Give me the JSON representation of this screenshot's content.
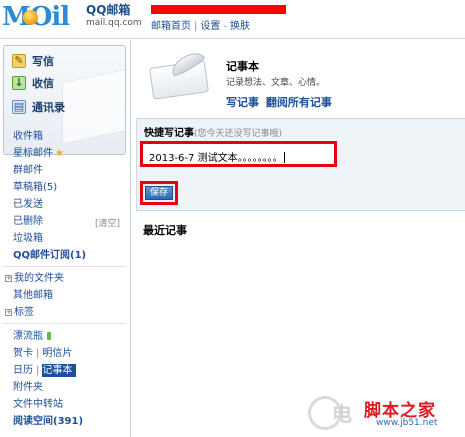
{
  "header": {
    "logo_text": "MOil",
    "brand_name": "QQ邮箱",
    "brand_domain": "mail.qq.com",
    "links": [
      "邮箱首页",
      "设置",
      "换肤"
    ],
    "colors": {
      "logo": "#2a8ad6",
      "redaction": "#ff0000"
    }
  },
  "sidebar": {
    "actions": [
      {
        "label": "写信",
        "icon": "pencil-icon"
      },
      {
        "label": "收信",
        "icon": "inbox-icon"
      },
      {
        "label": "通讯录",
        "icon": "address-book-icon"
      }
    ],
    "folders": {
      "inbox": "收件箱",
      "starred": "星标邮件",
      "group": "群邮件",
      "drafts": "草稿箱",
      "drafts_count": "(5)",
      "sent": "已发送",
      "deleted": "已删除",
      "clear": "[清空]",
      "trash": "垃圾箱",
      "subscription": "QQ邮件订阅",
      "subscription_count": "(1)"
    },
    "groups": {
      "my_folders": "我的文件夹",
      "other_mailboxes": "其他邮箱",
      "tags": "标签"
    },
    "apps": {
      "drift_bottle": "漂流瓶",
      "greeting_card": "贺卡",
      "postcard": "明信片",
      "calendar": "日历",
      "notebook": "记事本",
      "attachments": "附件夹",
      "file_transfer": "文件中转站",
      "reading": "阅读空间",
      "reading_count": "(391)"
    }
  },
  "main": {
    "title": "记事本",
    "subtitle": "记录想法、文章、心情。",
    "links": [
      "写记事",
      "翻阅所有记事"
    ],
    "quick": {
      "title": "快捷写记事",
      "hint": "(您今天还没写记事哦)",
      "input_value": "2013-6-7 测试文本。。。。。。。。",
      "save_label": "保存"
    },
    "recent_title": "最近记事"
  },
  "watermark": {
    "char": "电",
    "name": "脚本之家",
    "url": "www.jb51.net"
  }
}
